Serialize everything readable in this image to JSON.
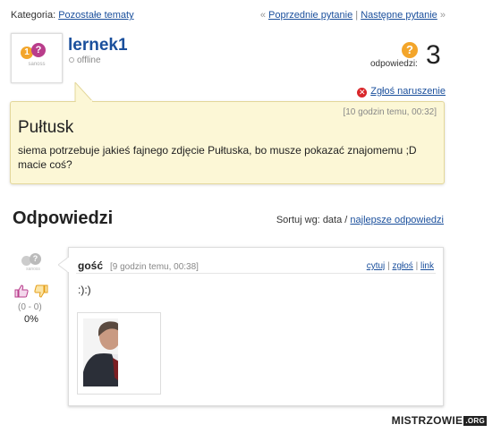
{
  "topbar": {
    "category_label": "Kategoria:",
    "category_link": "Pozostałe tematy",
    "prev_arrow": "«",
    "prev_link": "Poprzednie pytanie",
    "separator": "|",
    "next_link": "Następne pytanie",
    "next_arrow": "»"
  },
  "user": {
    "avatar_text": "sanoss",
    "name": "lernek1",
    "status": "offline"
  },
  "answers": {
    "label": "odpowiedzi:",
    "count": "3"
  },
  "report": {
    "label": "Zgłoś naruszenie"
  },
  "question": {
    "time": "[10 godzin temu, 00:32]",
    "title": "Pułtusk",
    "body": "siema potrzebuje jakieś fajnego zdjęcie Pułtuska, bo musze pokazać znajomemu ;D macie coś?"
  },
  "answers_section": {
    "title": "Odpowiedzi",
    "sort_label": "Sortuj wg:",
    "sort_current": "data",
    "sort_sep": "/",
    "sort_alt": "najlepsze odpowiedzi"
  },
  "answer": {
    "author": "gość",
    "time": "[9 godzin temu, 00:38]",
    "action_quote": "cytuj",
    "action_report": "zgłoś",
    "action_link": "link",
    "action_sep": "|",
    "text": ":):)",
    "vote_score": "(0 - 0)",
    "vote_percent": "0%"
  },
  "watermark": {
    "brand": "MISTRZOWIE",
    "tld": ".ORG"
  },
  "colors": {
    "link": "#1a4f9c",
    "question_bg": "#fcf7d6",
    "answers_icon": "#f3a52a",
    "report_icon": "#d9272b"
  }
}
